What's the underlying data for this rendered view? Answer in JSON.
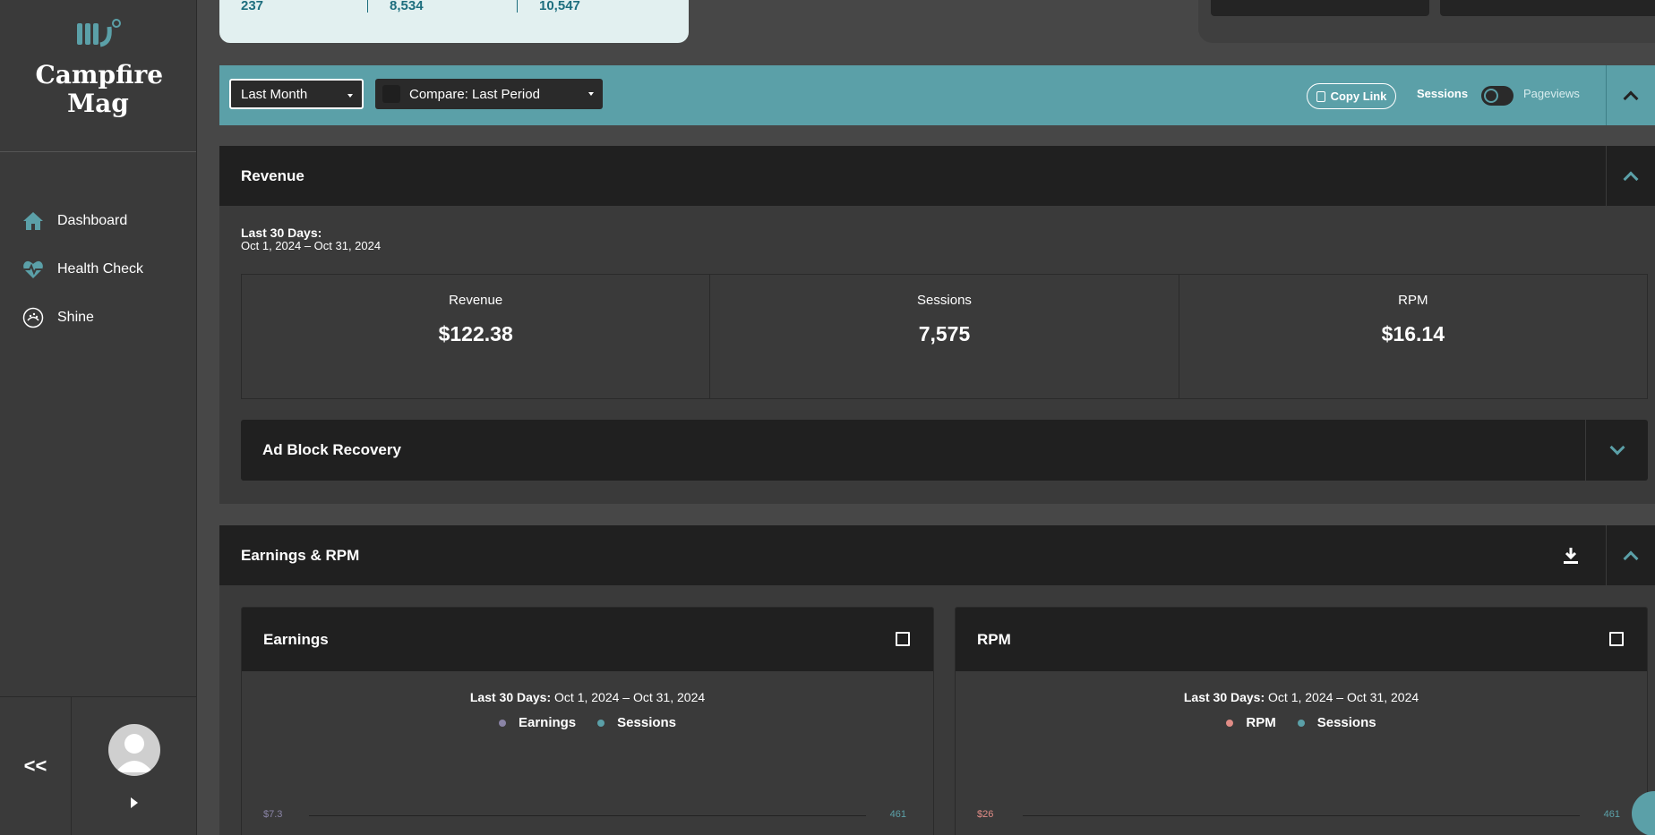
{
  "brand": {
    "name": "Campfire Mag"
  },
  "sidebar": {
    "items": [
      {
        "label": "Dashboard",
        "icon": "home-icon"
      },
      {
        "label": "Health Check",
        "icon": "heartbeat-icon"
      },
      {
        "label": "Shine",
        "icon": "shine-icon"
      }
    ],
    "collapse_label": "<<"
  },
  "top_stats": [
    "237",
    "8,534",
    "10,547"
  ],
  "filters": {
    "period": "Last Month",
    "compare": "Compare: Last Period",
    "copy_link": "Copy Link",
    "toggle_left": "Sessions",
    "toggle_right": "Pageviews"
  },
  "revenue": {
    "title": "Revenue",
    "period_label": "Last 30 Days:",
    "period_range": "Oct 1, 2024 – Oct 31, 2024",
    "kpis": [
      {
        "label": "Revenue",
        "value": "$122.38"
      },
      {
        "label": "Sessions",
        "value": "7,575"
      },
      {
        "label": "RPM",
        "value": "$16.14"
      }
    ],
    "adblock_title": "Ad Block Recovery"
  },
  "earnings_rpm": {
    "title": "Earnings & RPM",
    "charts": [
      {
        "title": "Earnings",
        "period_label": "Last 30 Days:",
        "period_range": "Oct 1, 2024 – Oct 31, 2024",
        "legend": [
          "Earnings",
          "Sessions"
        ],
        "legend_colors": [
          "#8a84a6",
          "#5ba0a8"
        ],
        "y_left_top": "$7.3",
        "y_right_top": "461"
      },
      {
        "title": "RPM",
        "period_label": "Last 30 Days:",
        "period_range": "Oct 1, 2024 – Oct 31, 2024",
        "legend": [
          "RPM",
          "Sessions"
        ],
        "legend_colors": [
          "#e08c86",
          "#5ba0a8"
        ],
        "y_left_top": "$26",
        "y_right_top": "461"
      }
    ]
  },
  "colors": {
    "accent": "#5ba0a8",
    "panel_dark": "#202020",
    "bg": "#474747"
  }
}
